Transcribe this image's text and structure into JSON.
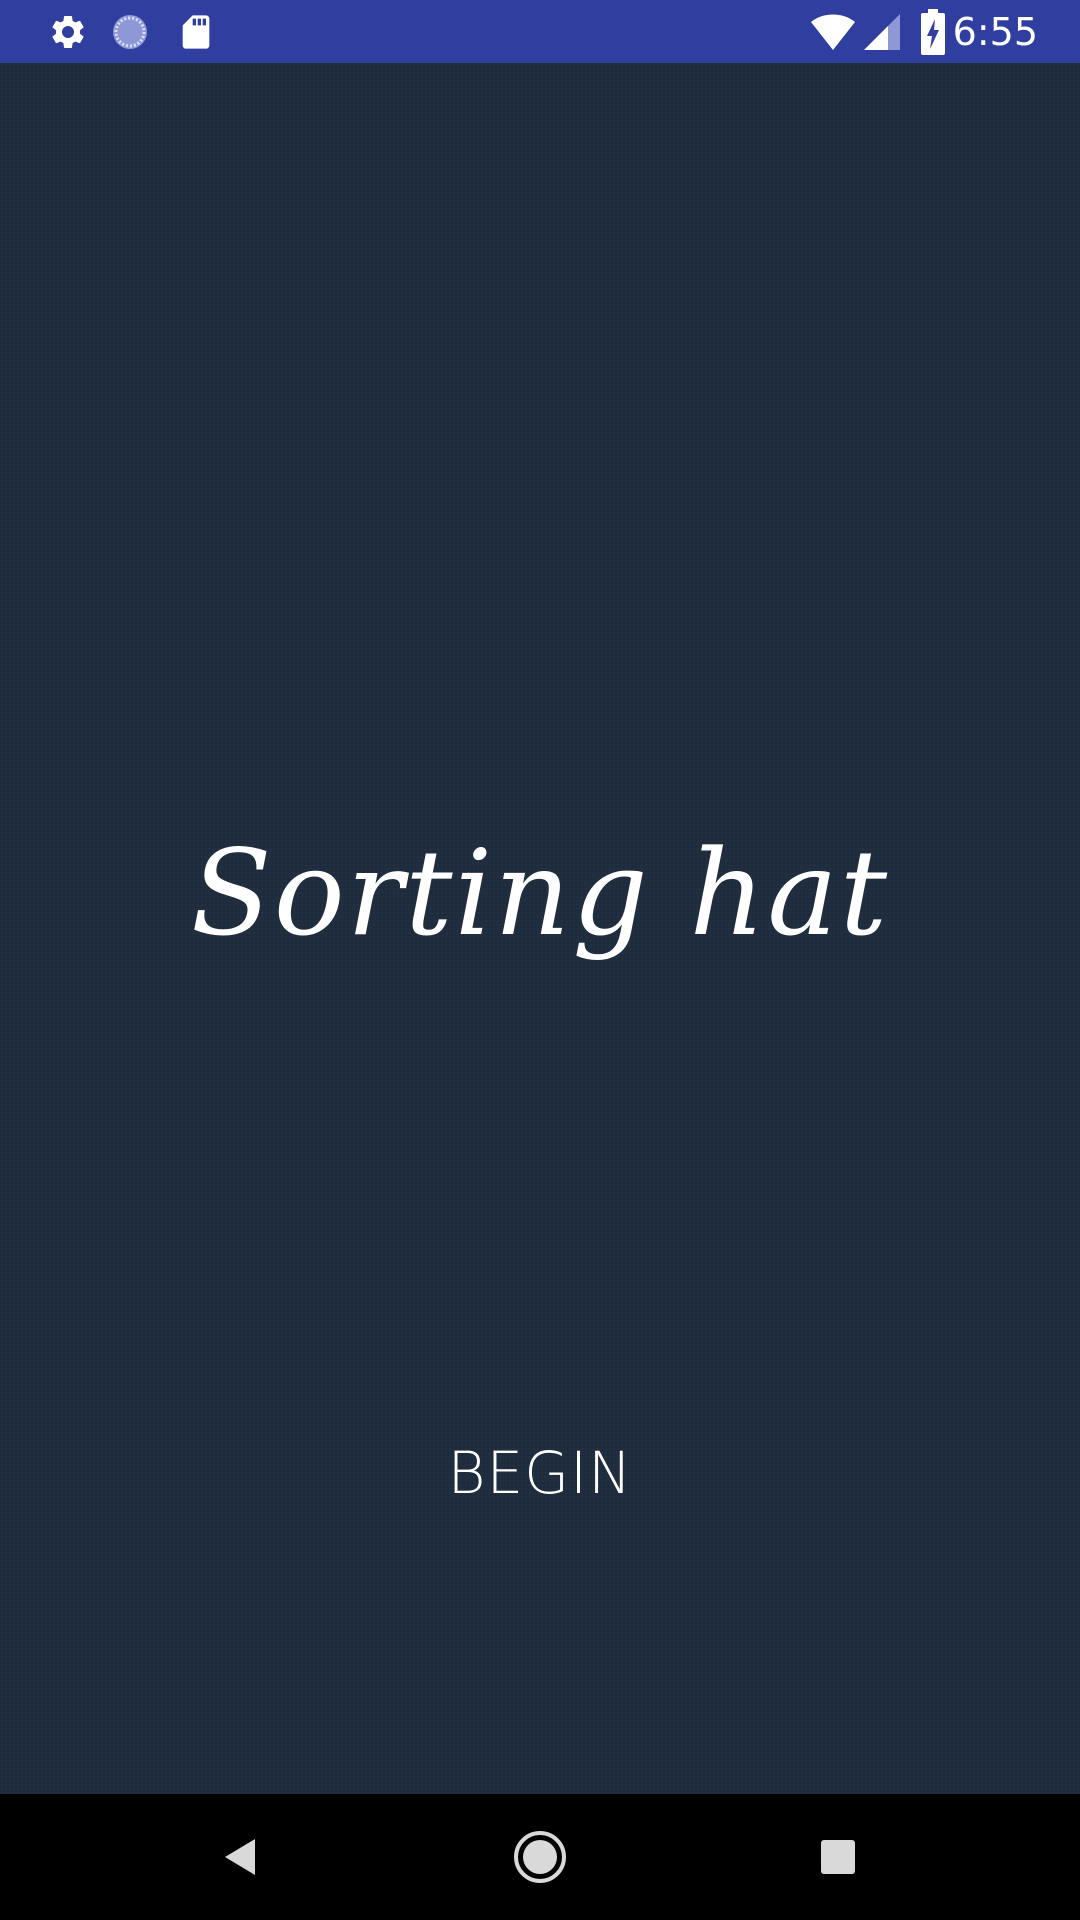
{
  "status_bar": {
    "time": "6:55",
    "icons": [
      "gear-icon",
      "sync-icon",
      "sd-card-icon",
      "wifi-icon",
      "cell-signal-icon",
      "battery-charging-icon"
    ],
    "color": "#303f9f"
  },
  "main": {
    "title": "Sorting hat",
    "begin_label": "BEGIN",
    "background_color": "#1f2c3e",
    "text_color": "#ffffff"
  },
  "nav_bar": {
    "buttons": [
      "back-icon",
      "home-icon",
      "recents-icon"
    ],
    "color": "#000000"
  }
}
